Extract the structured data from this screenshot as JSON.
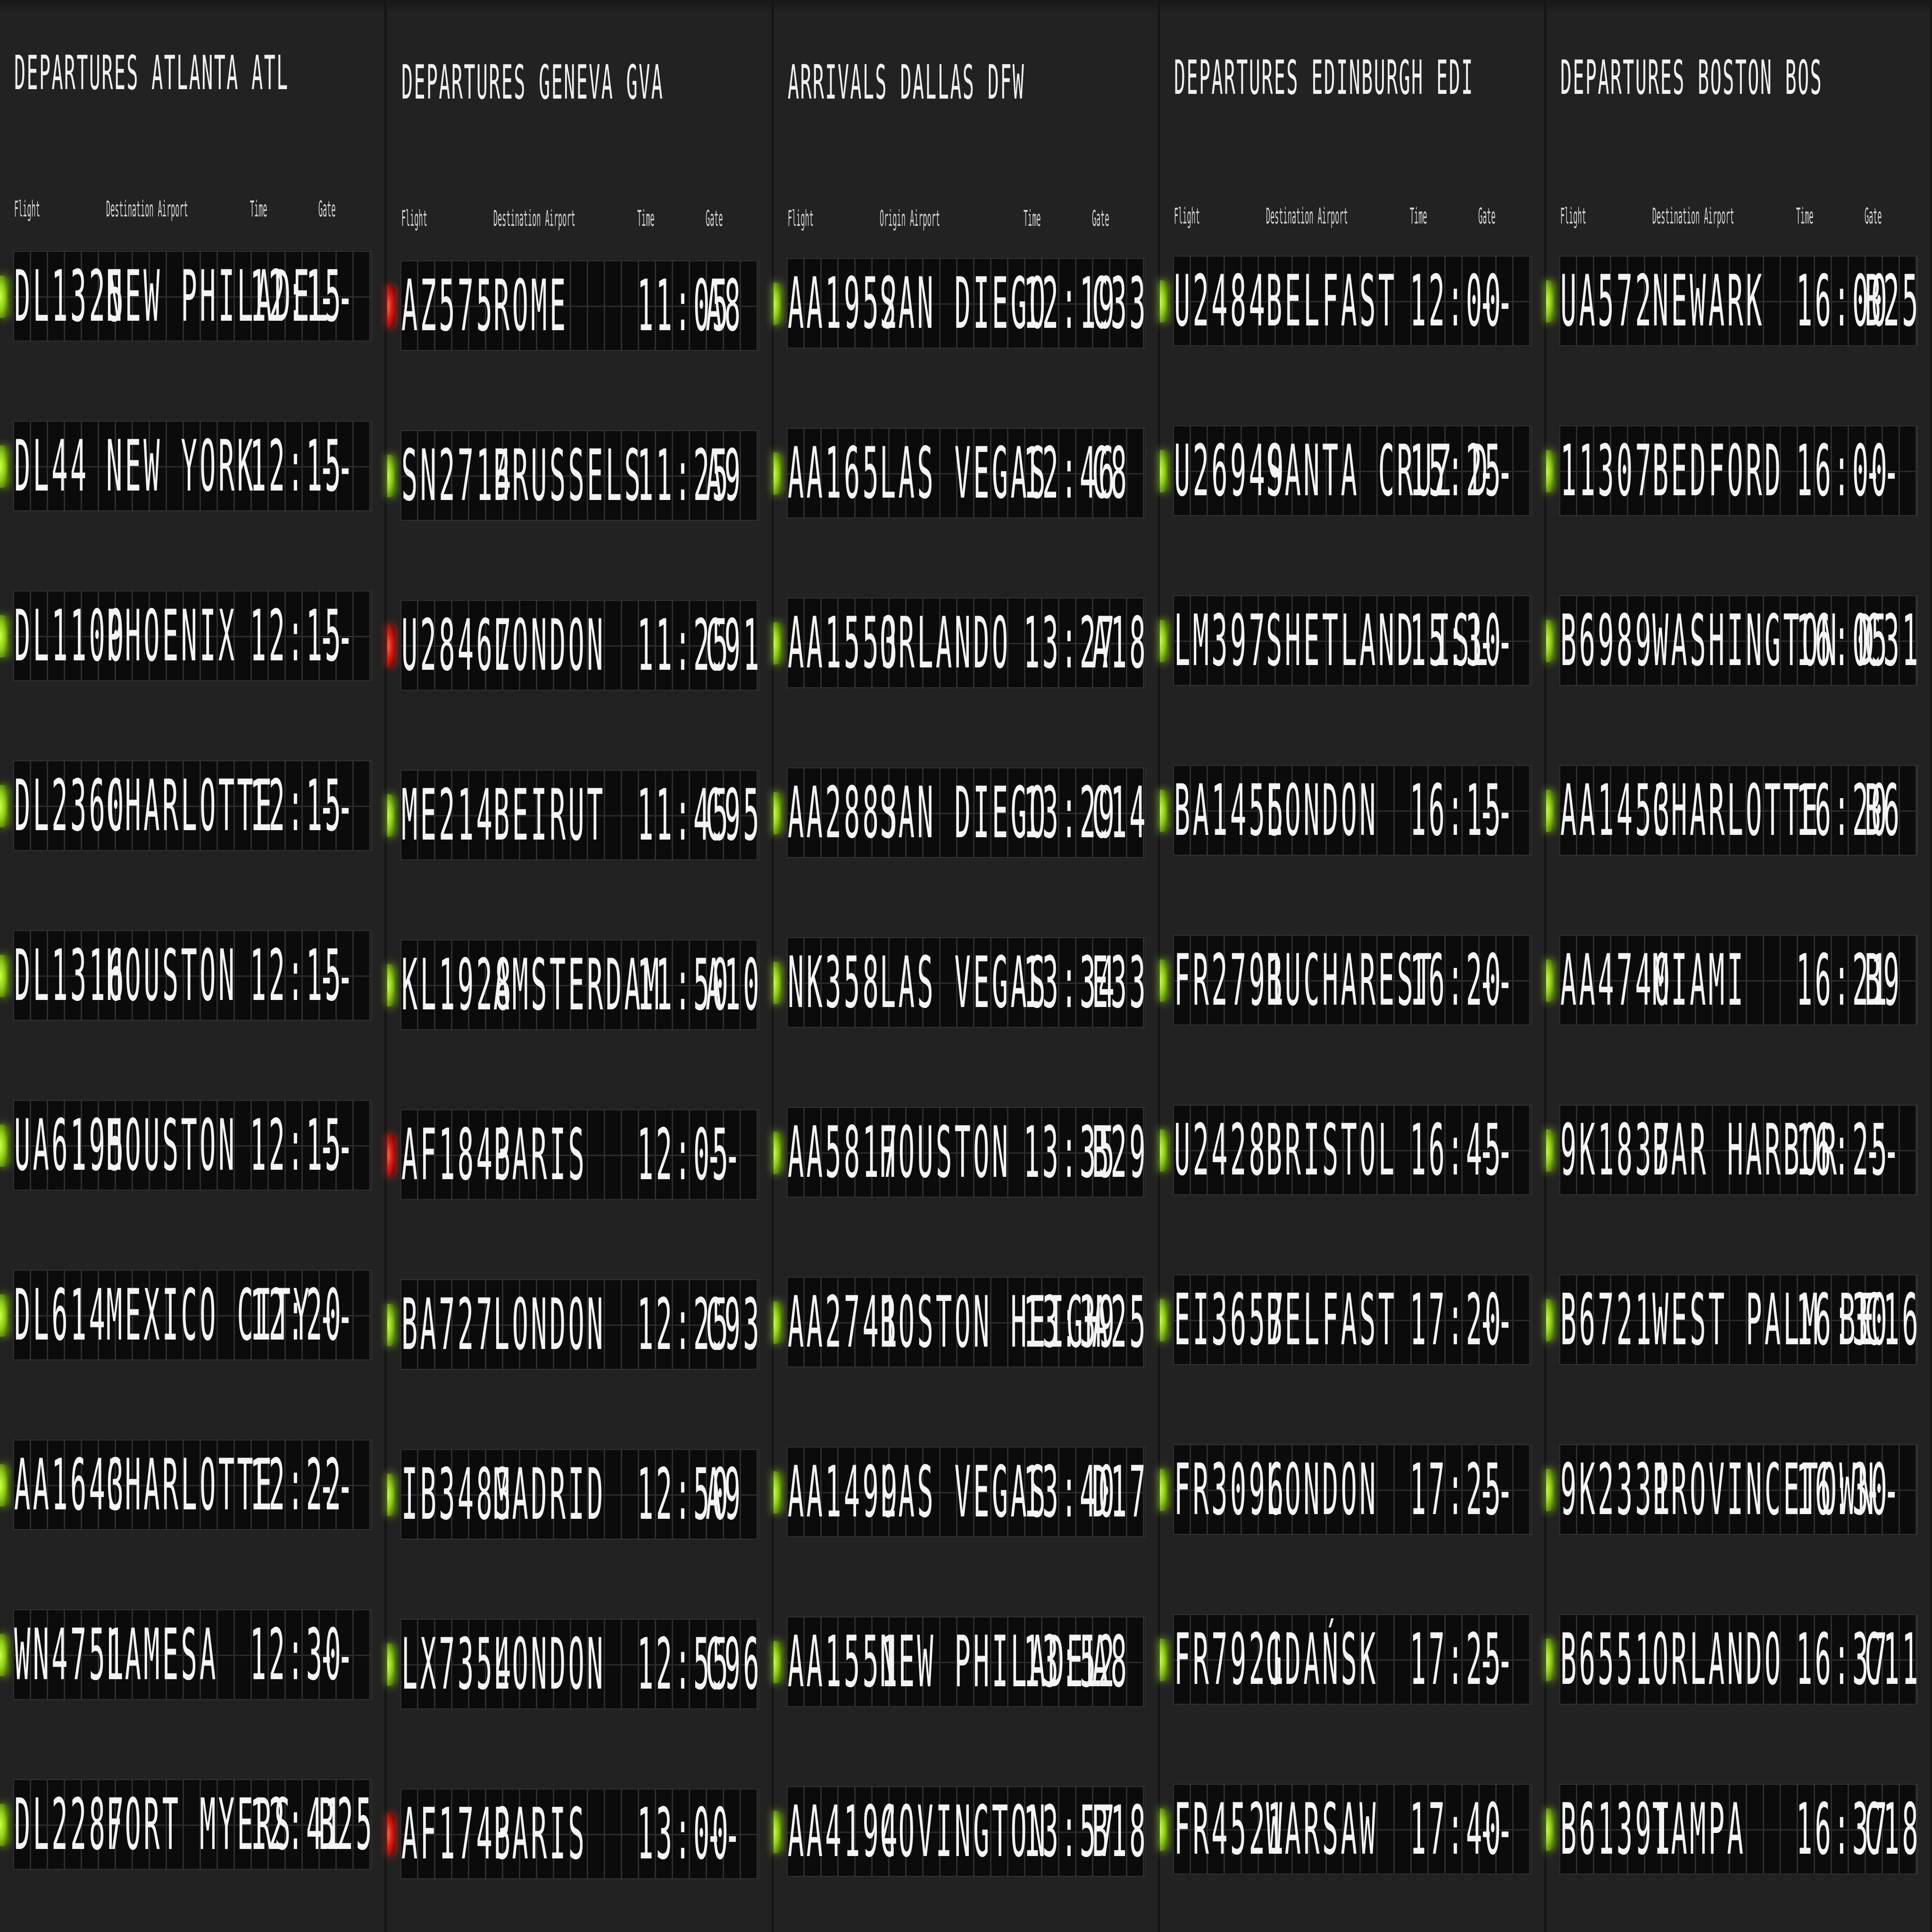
{
  "columns": {
    "flight": "Flight",
    "destination": "Destination Airport",
    "origin": "Origin Airport",
    "time": "Time",
    "gate": "Gate"
  },
  "colors": {
    "on_time": "#8fcf19",
    "alert": "#e01a10",
    "background": "#1c1c1c"
  },
  "boards": [
    {
      "title": "DEPARTURES ATLANTA ATL",
      "place_header": "Destination Airport",
      "rows": [
        {
          "flight": "DL1325",
          "place": "NEW PHILADEL",
          "time": "12:15",
          "gate": "--",
          "status": "green"
        },
        {
          "flight": "DL44",
          "place": "NEW YORK",
          "time": "12:15",
          "gate": "--",
          "status": "green"
        },
        {
          "flight": "DL1100",
          "place": "PHOENIX",
          "time": "12:15",
          "gate": "--",
          "status": "green"
        },
        {
          "flight": "DL2360",
          "place": "CHARLOTTE",
          "time": "12:15",
          "gate": "--",
          "status": "green"
        },
        {
          "flight": "DL1316",
          "place": "HOUSTON",
          "time": "12:15",
          "gate": "--",
          "status": "green"
        },
        {
          "flight": "UA6195",
          "place": "HOUSTON",
          "time": "12:15",
          "gate": "--",
          "status": "green"
        },
        {
          "flight": "DL614",
          "place": "MEXICO CITY",
          "time": "12:20",
          "gate": "--",
          "status": "green"
        },
        {
          "flight": "AA1643",
          "place": "CHARLOTTE",
          "time": "12:22",
          "gate": "--",
          "status": "green"
        },
        {
          "flight": "WN4751",
          "place": "LAMESA",
          "time": "12:30",
          "gate": "--",
          "status": "green"
        },
        {
          "flight": "DL2287",
          "place": "FORT MYERS",
          "time": "12:41",
          "gate": "B25",
          "status": "green"
        }
      ]
    },
    {
      "title": "DEPARTURES GENEVA GVA",
      "place_header": "Destination Airport",
      "rows": [
        {
          "flight": "AZ575",
          "place": "ROME",
          "time": "11:05",
          "gate": "A8",
          "status": "red"
        },
        {
          "flight": "SN2714",
          "place": "BRUSSELS",
          "time": "11:25",
          "gate": "A9",
          "status": "green"
        },
        {
          "flight": "U28467",
          "place": "LONDON",
          "time": "11:25",
          "gate": "C91",
          "status": "red"
        },
        {
          "flight": "ME214",
          "place": "BEIRUT",
          "time": "11:45",
          "gate": "C95",
          "status": "green"
        },
        {
          "flight": "KL1928",
          "place": "AMSTERDAM",
          "time": "11:50",
          "gate": "A10",
          "status": "green"
        },
        {
          "flight": "AF1843",
          "place": "PARIS",
          "time": "12:05",
          "gate": "--",
          "status": "red"
        },
        {
          "flight": "BA727",
          "place": "LONDON",
          "time": "12:25",
          "gate": "C93",
          "status": "green"
        },
        {
          "flight": "IB3483",
          "place": "MADRID",
          "time": "12:50",
          "gate": "A9",
          "status": "green"
        },
        {
          "flight": "LX7354",
          "place": "LONDON",
          "time": "12:55",
          "gate": "C96",
          "status": "green"
        },
        {
          "flight": "AF1743",
          "place": "PARIS",
          "time": "13:00",
          "gate": "--",
          "status": "red"
        }
      ]
    },
    {
      "title": "ARRIVALS DALLAS DFW",
      "place_header": "Origin Airport",
      "rows": [
        {
          "flight": "AA1952",
          "place": "SAN DIEGO",
          "time": "12:19",
          "gate": "C33",
          "status": "green"
        },
        {
          "flight": "AA165",
          "place": "LAS VEGAS",
          "time": "12:46",
          "gate": "C8",
          "status": "green"
        },
        {
          "flight": "AA1553",
          "place": "ORLANDO",
          "time": "13:27",
          "gate": "A18",
          "status": "green"
        },
        {
          "flight": "AA2883",
          "place": "SAN DIEGO",
          "time": "13:29",
          "gate": "C14",
          "status": "green"
        },
        {
          "flight": "NK358",
          "place": "LAS VEGAS",
          "time": "13:34",
          "gate": "E33",
          "status": "green"
        },
        {
          "flight": "AA5817",
          "place": "HOUSTON",
          "time": "13:35",
          "gate": "B29",
          "status": "green"
        },
        {
          "flight": "AA2741",
          "place": "BOSTON HEIGH",
          "time": "13:39",
          "gate": "A25",
          "status": "green"
        },
        {
          "flight": "AA1499",
          "place": "LAS VEGAS",
          "time": "13:40",
          "gate": "D17",
          "status": "green"
        },
        {
          "flight": "AA1551",
          "place": "NEW PHILADEL",
          "time": "13:52",
          "gate": "A8",
          "status": "green"
        },
        {
          "flight": "AA4194",
          "place": "COVINGTON",
          "time": "13:57",
          "gate": "B18",
          "status": "green"
        }
      ]
    },
    {
      "title": "DEPARTURES EDINBURGH EDI",
      "place_header": "Destination Airport",
      "rows": [
        {
          "flight": "U2484",
          "place": "BELFAST",
          "time": "12:00",
          "gate": "--",
          "status": "green"
        },
        {
          "flight": "U26949",
          "place": "SANTA CRUZ D",
          "time": "15:25",
          "gate": "--",
          "status": "green"
        },
        {
          "flight": "LM397",
          "place": "SHETLAND ISL",
          "time": "15:30",
          "gate": "--",
          "status": "green"
        },
        {
          "flight": "BA1455",
          "place": "LONDON",
          "time": "16:15",
          "gate": "--",
          "status": "green"
        },
        {
          "flight": "FR2791",
          "place": "BUCHAREST",
          "time": "16:20",
          "gate": "--",
          "status": "green"
        },
        {
          "flight": "U2428",
          "place": "BRISTOL",
          "time": "16:45",
          "gate": "--",
          "status": "green"
        },
        {
          "flight": "EI3657",
          "place": "BELFAST",
          "time": "17:20",
          "gate": "--",
          "status": "green"
        },
        {
          "flight": "FR3096",
          "place": "LONDON",
          "time": "17:25",
          "gate": "--",
          "status": "green"
        },
        {
          "flight": "FR7921",
          "place": "GDAŃSK",
          "time": "17:25",
          "gate": "--",
          "status": "green"
        },
        {
          "flight": "FR4521",
          "place": "WARSAW",
          "time": "17:40",
          "gate": "--",
          "status": "green"
        }
      ]
    },
    {
      "title": "DEPARTURES BOSTON BOS",
      "place_header": "Destination Airport",
      "rows": [
        {
          "flight": "UA572",
          "place": "NEWARK",
          "time": "16:00",
          "gate": "B25",
          "status": "green"
        },
        {
          "flight": "11307",
          "place": "BEDFORD",
          "time": "16:00",
          "gate": "--",
          "status": "green"
        },
        {
          "flight": "B6989",
          "place": "WASHINGTON D",
          "time": "16:05",
          "gate": "C31",
          "status": "green"
        },
        {
          "flight": "AA1453",
          "place": "CHARLOTTE",
          "time": "16:20",
          "gate": "B6",
          "status": "green"
        },
        {
          "flight": "AA4740",
          "place": "MIAMI",
          "time": "16:21",
          "gate": "B9",
          "status": "green"
        },
        {
          "flight": "9K1837",
          "place": "BAR HARBOR",
          "time": "16:25",
          "gate": "--",
          "status": "green"
        },
        {
          "flight": "B6721",
          "place": "WEST PALM BE",
          "time": "16:30",
          "gate": "C16",
          "status": "green"
        },
        {
          "flight": "9K2331",
          "place": "PROVINCETOWN",
          "time": "16:30",
          "gate": "--",
          "status": "green"
        },
        {
          "flight": "B6551",
          "place": "ORLANDO",
          "time": "16:37",
          "gate": "C11",
          "status": "green"
        },
        {
          "flight": "B61391",
          "place": "TAMPA",
          "time": "16:37",
          "gate": "C18",
          "status": "green"
        }
      ]
    }
  ]
}
